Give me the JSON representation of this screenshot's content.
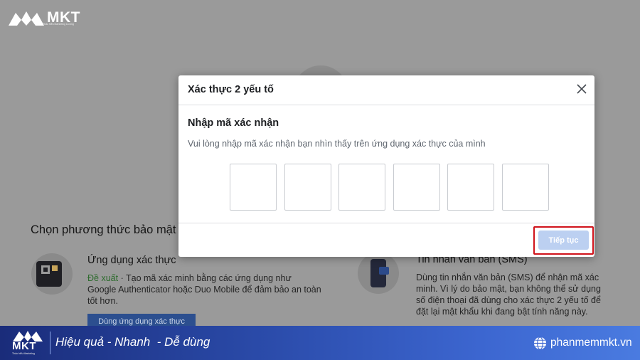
{
  "logo": {
    "text": "MKT",
    "subtitle": "Thấu hiểu Marketing & cộng"
  },
  "modal": {
    "title": "Xác thực 2 yếu tố",
    "heading": "Nhập mã xác nhận",
    "subtitle": "Vui lòng nhập mã xác nhận bạn nhìn thấy trên ứng dụng xác thực của mình",
    "code_digits": [
      "",
      "",
      "",
      "",
      "",
      ""
    ],
    "continue_label": "Tiếp tục"
  },
  "background": {
    "section_title": "Chọn phương thức bảo mật",
    "auth_app": {
      "title": "Ứng dụng xác thực",
      "recommended": "Đề xuất",
      "description": " · Tạo mã xác minh bằng các ứng dụng như Google Authenticator hoặc Duo Mobile để đảm bảo an toàn tốt hơn.",
      "button_label": "Dùng ứng dụng xác thực"
    },
    "sms": {
      "title": "Tin nhắn văn bản (SMS)",
      "description": "Dùng tin nhắn văn bản (SMS) để nhận mã xác minh. Vì lý do bảo mật, bạn không thể sử dụng số điện thoại đã dùng cho xác thực 2 yếu tố để đặt lại mật khẩu khi đang bật tính năng này."
    }
  },
  "banner": {
    "logo_text": "MKT",
    "logo_subtitle": "Thấu hiểu Marketing",
    "slogan": "Hiệu quả - Nhanh  - Dễ dùng",
    "website": "phanmemmkt.vn"
  },
  "colors": {
    "overlay_bg": "#9a9a9a",
    "modal_bg": "#ffffff",
    "continue_disabled": "#bcd0f1",
    "highlight_red": "#d0131b",
    "banner_start": "#1a2c7a",
    "banner_end": "#4a7be0"
  }
}
